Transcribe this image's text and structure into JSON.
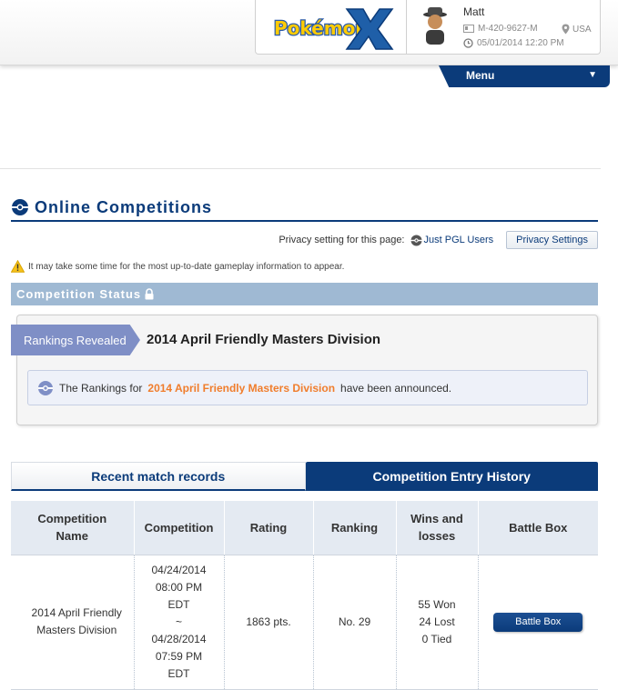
{
  "header": {
    "logo_alt": "Pokémon X",
    "user": {
      "name": "Matt",
      "id": "M-420-9627-M",
      "country": "USA",
      "datetime": "05/01/2014 12:20 PM"
    },
    "menu_label": "Menu"
  },
  "page": {
    "title": "Online Competitions",
    "privacy_label": "Privacy setting for this page:",
    "privacy_value": "Just PGL Users",
    "privacy_button": "Privacy Settings",
    "warning_text": "It may take some time for the most up-to-date gameplay information to appear."
  },
  "status": {
    "section_label": "Competition Status",
    "badge": "Rankings Revealed",
    "competition_title": "2014 April Friendly Masters Division",
    "notice_prefix": "The Rankings for",
    "notice_highlight": "2014 April Friendly Masters Division",
    "notice_suffix": "have been announced."
  },
  "tabs": [
    {
      "label": "Recent match records",
      "active": false
    },
    {
      "label": "Competition Entry History",
      "active": true
    }
  ],
  "table": {
    "headers": {
      "name": [
        "Competition",
        "Name"
      ],
      "competition": "Competition",
      "rating": "Rating",
      "ranking": "Ranking",
      "wins": [
        "Wins and",
        "losses"
      ],
      "battle_box": "Battle Box"
    },
    "rows": [
      {
        "name_line1": "2014 April Friendly",
        "name_line2": "Masters Division",
        "start_date": "04/24/2014",
        "start_time": "08:00 PM",
        "start_tz": "EDT",
        "range_sep": "~",
        "end_date": "04/28/2014",
        "end_time": "07:59 PM",
        "end_tz": "EDT",
        "rating": "1863 pts.",
        "ranking": "No. 29",
        "won": "55 Won",
        "lost": "24 Lost",
        "tied": "0 Tied",
        "battle_box_label": "Battle Box"
      }
    ]
  },
  "colors": {
    "primary": "#0b3b7a",
    "status_bar": "#9fb9d3",
    "badge": "#7f8fc6",
    "highlight": "#f07d2c"
  }
}
